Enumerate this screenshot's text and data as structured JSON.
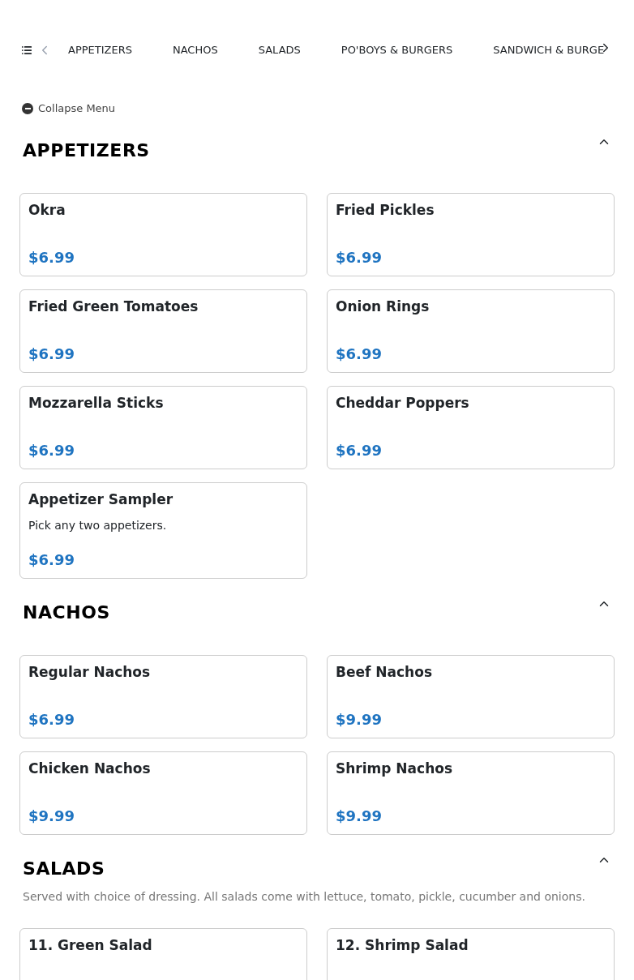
{
  "nav": {
    "tabs": [
      {
        "label": "APPETIZERS",
        "selected": false
      },
      {
        "label": "NACHOS",
        "selected": false
      },
      {
        "label": "SALADS",
        "selected": false
      },
      {
        "label": "PO'BOYS & BURGERS",
        "selected": false
      },
      {
        "label": "SANDWICH & BURGE",
        "selected": false
      }
    ]
  },
  "collapse_button": {
    "label": "Collapse Menu"
  },
  "sections": [
    {
      "title": "APPETIZERS",
      "expanded": true,
      "items": [
        {
          "name": "Okra",
          "price": "$6.99"
        },
        {
          "name": "Fried Pickles",
          "price": "$6.99"
        },
        {
          "name": "Fried Green Tomatoes",
          "price": "$6.99"
        },
        {
          "name": "Onion Rings",
          "price": "$6.99"
        },
        {
          "name": "Mozzarella Sticks",
          "price": "$6.99"
        },
        {
          "name": "Cheddar Poppers",
          "price": "$6.99"
        },
        {
          "name": "Appetizer Sampler",
          "description": "Pick any two appetizers.",
          "price": "$6.99"
        }
      ]
    },
    {
      "title": "NACHOS",
      "expanded": true,
      "items": [
        {
          "name": "Regular Nachos",
          "price": "$6.99"
        },
        {
          "name": "Beef Nachos",
          "price": "$9.99"
        },
        {
          "name": "Chicken Nachos",
          "price": "$9.99"
        },
        {
          "name": "Shrimp Nachos",
          "price": "$9.99"
        }
      ]
    },
    {
      "title": "SALADS",
      "expanded": true,
      "description": "Served with choice of dressing. All salads come with lettuce, tomato, pickle, cucumber and onions.",
      "items": [
        {
          "name": "11. Green Salad"
        },
        {
          "name": "12. Shrimp Salad"
        }
      ]
    }
  ]
}
